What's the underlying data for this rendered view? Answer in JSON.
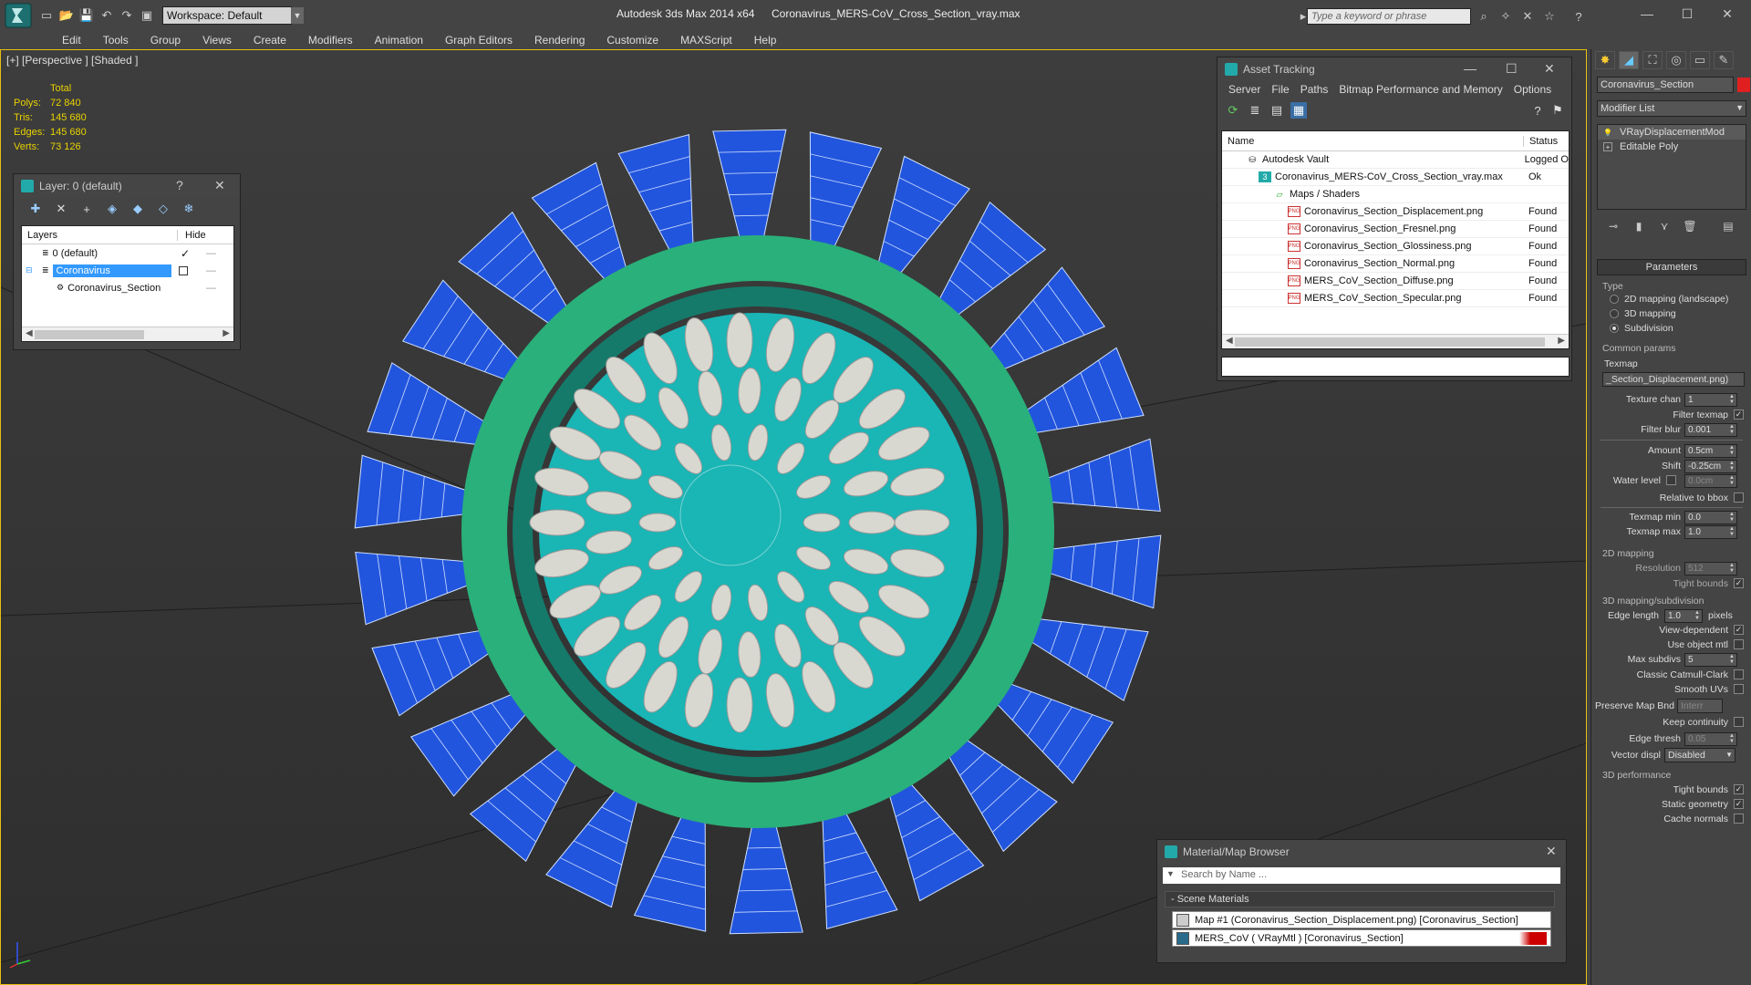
{
  "titlebar": {
    "workspace": "Workspace: Default",
    "app_title": "Autodesk 3ds Max  2014 x64",
    "file_title": "Coronavirus_MERS-CoV_Cross_Section_vray.max",
    "search_placeholder": "Type a keyword or phrase"
  },
  "menu": [
    "Edit",
    "Tools",
    "Group",
    "Views",
    "Create",
    "Modifiers",
    "Animation",
    "Graph Editors",
    "Rendering",
    "Customize",
    "MAXScript",
    "Help"
  ],
  "viewport": {
    "label": "[+] [Perspective ] [Shaded ]",
    "stats_header": "Total",
    "stats": [
      {
        "k": "Polys:",
        "v": "72 840"
      },
      {
        "k": "Tris:",
        "v": "145 680"
      },
      {
        "k": "Edges:",
        "v": "145 680"
      },
      {
        "k": "Verts:",
        "v": "73 126"
      }
    ],
    "colors": {
      "spike": "#2255dd",
      "membrane": "#2ab07a",
      "core": "#1ab5b5",
      "coil": "#d8d8d0"
    }
  },
  "layer_window": {
    "title": "Layer: 0 (default)",
    "help": "?",
    "col_layers": "Layers",
    "col_hide": "Hide",
    "rows": [
      {
        "label": "0 (default)"
      },
      {
        "label": "Coronavirus"
      },
      {
        "label": "Coronavirus_Section"
      }
    ]
  },
  "asset_window": {
    "title": "Asset Tracking",
    "menu": [
      "Server",
      "File",
      "Paths",
      "Bitmap Performance and Memory",
      "Options"
    ],
    "col_name": "Name",
    "col_status": "Status",
    "rows": [
      {
        "name": "Autodesk Vault",
        "status": "Logged O",
        "indent": 0
      },
      {
        "name": "Coronavirus_MERS-CoV_Cross_Section_vray.max",
        "status": "Ok",
        "indent": 1
      },
      {
        "name": "Maps / Shaders",
        "status": "",
        "indent": 2
      },
      {
        "name": "Coronavirus_Section_Displacement.png",
        "status": "Found",
        "indent": 3
      },
      {
        "name": "Coronavirus_Section_Fresnel.png",
        "status": "Found",
        "indent": 3
      },
      {
        "name": "Coronavirus_Section_Glossiness.png",
        "status": "Found",
        "indent": 3
      },
      {
        "name": "Coronavirus_Section_Normal.png",
        "status": "Found",
        "indent": 3
      },
      {
        "name": "MERS_CoV_Section_Diffuse.png",
        "status": "Found",
        "indent": 3
      },
      {
        "name": "MERS_CoV_Section_Specular.png",
        "status": "Found",
        "indent": 3
      }
    ]
  },
  "material_browser": {
    "title": "Material/Map Browser",
    "search_placeholder": "Search by Name ...",
    "group": "- Scene Materials",
    "items": [
      "Map #1 (Coronavirus_Section_Displacement.png) [Coronavirus_Section]",
      "MERS_CoV  ( VRayMtl ) [Coronavirus_Section]"
    ]
  },
  "command_panel": {
    "object_name": "Coronavirus_Section",
    "modifier_list": "Modifier List",
    "stack": [
      "VRayDisplacementMod",
      "Editable Poly"
    ],
    "rollout": "Parameters",
    "type_label": "Type",
    "type_options": [
      "2D mapping (landscape)",
      "3D mapping",
      "Subdivision"
    ],
    "common_params": "Common params",
    "texmap_label": "Texmap",
    "texmap_value": "_Section_Displacement.png)",
    "texture_chan_label": "Texture chan",
    "texture_chan": "1",
    "filter_texmap": "Filter texmap",
    "filter_blur_label": "Filter blur",
    "filter_blur": "0.001",
    "amount_label": "Amount",
    "amount": "0.5cm",
    "shift_label": "Shift",
    "shift": "-0.25cm",
    "water_level_label": "Water level",
    "water_level": "0.0cm",
    "relative_bbox": "Relative to bbox",
    "texmap_min_label": "Texmap min",
    "texmap_min": "0.0",
    "texmap_max_label": "Texmap max",
    "texmap_max": "1.0",
    "group_2d": "2D mapping",
    "resolution_label": "Resolution",
    "resolution": "512",
    "tight_bounds": "Tight bounds",
    "group_3d": "3D mapping/subdivision",
    "edge_length_label": "Edge length",
    "edge_length": "1.0",
    "pixels": "pixels",
    "view_dependent": "View-dependent",
    "use_object_mtl": "Use object mtl",
    "max_subdivs_label": "Max subdivs",
    "max_subdivs": "5",
    "catmull": "Classic Catmull-Clark",
    "smooth_uvs": "Smooth UVs",
    "preserve_map_label": "Preserve Map Bnd",
    "preserve_map": "Interr",
    "keep_continuity": "Keep continuity",
    "edge_thresh_label": "Edge thresh",
    "edge_thresh": "0.05",
    "vector_displ_label": "Vector displ",
    "vector_displ": "Disabled",
    "group_perf": "3D performance",
    "tight_bounds2": "Tight bounds",
    "static_geometry": "Static geometry",
    "cache_normals": "Cache normals"
  }
}
